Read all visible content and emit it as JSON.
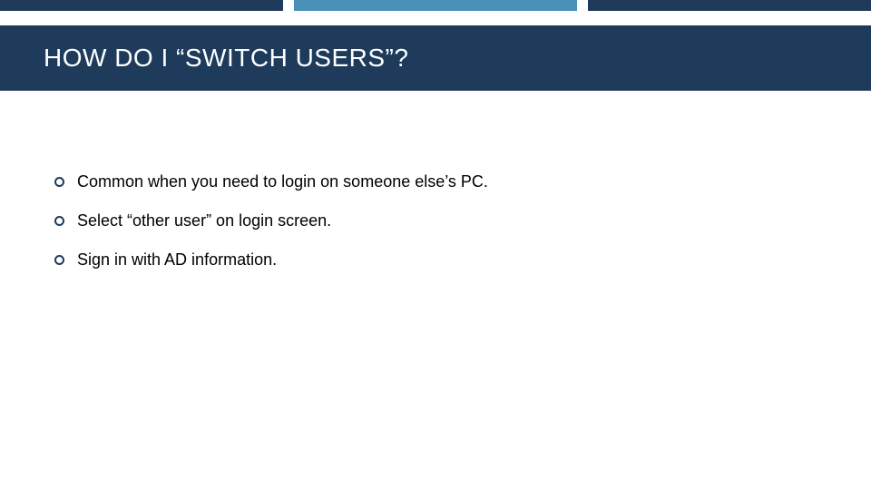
{
  "title": "HOW DO I “SWITCH USERS”?",
  "bullets": [
    "Common when you need to login on someone else’s PC.",
    "Select “other user” on login screen.",
    "Sign in with AD information."
  ]
}
